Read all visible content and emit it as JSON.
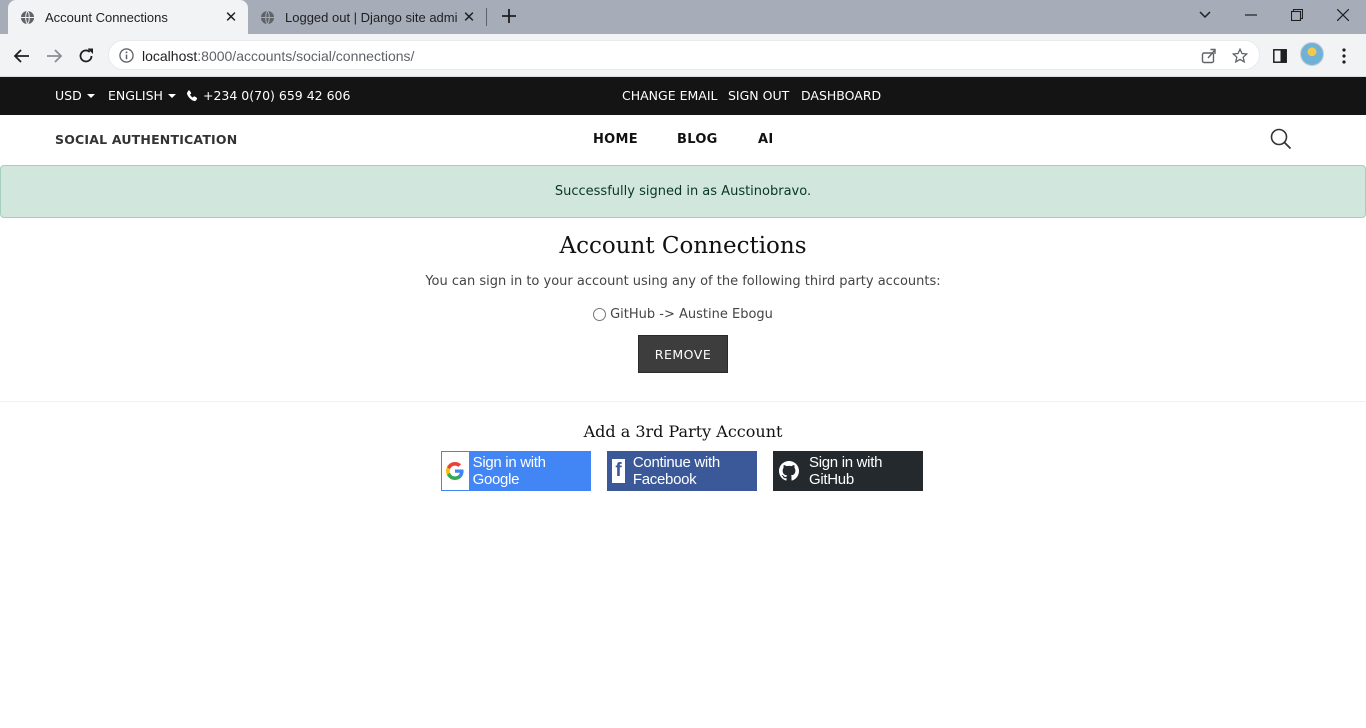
{
  "browser": {
    "tabs": [
      {
        "title": "Account Connections",
        "active": true
      },
      {
        "title": "Logged out | Django site admin",
        "active": false
      }
    ],
    "url_host": "localhost",
    "url_rest": ":8000/accounts/social/connections/"
  },
  "topbar": {
    "currency": "USD",
    "language": "ENGLISH",
    "phone": "+234 0(70) 659 42 606",
    "links": [
      "CHANGE EMAIL",
      "SIGN OUT",
      "DASHBOARD"
    ]
  },
  "nav": {
    "brand": "SOCIAL AUTHENTICATION",
    "links": [
      "HOME",
      "BLOG",
      "AI"
    ]
  },
  "alert": {
    "message": "Successfully signed in as Austinobravo."
  },
  "main": {
    "title": "Account Connections",
    "intro": "You can sign in to your account using any of the following third party accounts:",
    "connection": "GitHub -> Austine Ebogu",
    "remove_label": "REMOVE",
    "add_title": "Add a 3rd Party Account",
    "providers": [
      {
        "label": "Sign in with Google",
        "color": "#4285f4"
      },
      {
        "label": "Continue with Facebook",
        "color": "#3b5998"
      },
      {
        "label": "Sign in with GitHub",
        "color": "#24292e"
      }
    ]
  },
  "colors": {
    "topbar_bg": "#141414",
    "alert_bg": "#d1e7dd",
    "alert_text": "#0a3622",
    "button_dark": "#3d3d3d"
  }
}
